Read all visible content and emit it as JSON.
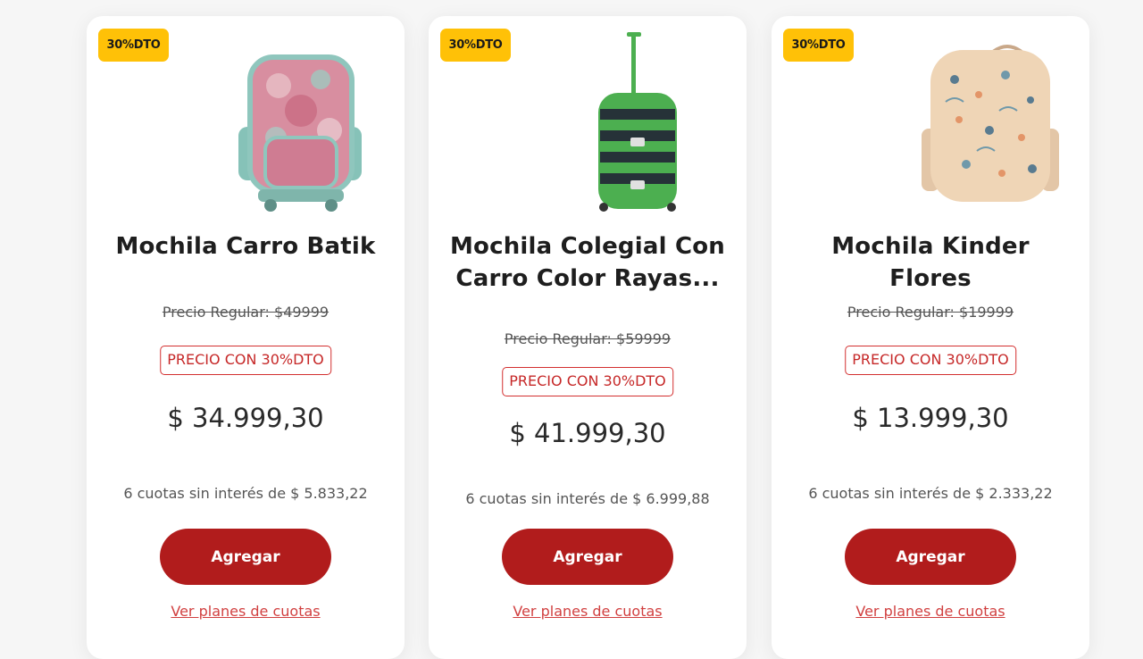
{
  "products": [
    {
      "badge": "30%DTO",
      "title": "Mochila Carro Batik",
      "regular_price": "Precio Regular: $49999",
      "discount_label": "PRECIO CON 30%DTO",
      "price": "$ 34.999,30",
      "installments": "6 cuotas sin interés de $ 5.833,22",
      "add_button": "Agregar",
      "plans_link": "Ver planes de cuotas",
      "image": "teal-batik-rolling-backpack"
    },
    {
      "badge": "30%DTO",
      "title": "Mochila Colegial Con\nCarro Color Rayas...",
      "regular_price": "Precio Regular: $59999",
      "discount_label": "PRECIO CON 30%DTO",
      "price": "$ 41.999,30",
      "installments": "6 cuotas sin interés de $ 6.999,88",
      "add_button": "Agregar",
      "plans_link": "Ver planes de cuotas",
      "image": "green-striped-rolling-backpack"
    },
    {
      "badge": "30%DTO",
      "title": "Mochila Kinder Flores",
      "regular_price": "Precio Regular: $19999",
      "discount_label": "PRECIO CON 30%DTO",
      "price": "$ 13.999,30",
      "installments": "6 cuotas sin interés de $ 2.333,22",
      "add_button": "Agregar",
      "plans_link": "Ver planes de cuotas",
      "image": "beige-floral-backpack"
    }
  ],
  "colors": {
    "badge": "#ffc107",
    "button": "#b11c1c",
    "discount_border": "#d32f2f",
    "link": "#d14040"
  }
}
